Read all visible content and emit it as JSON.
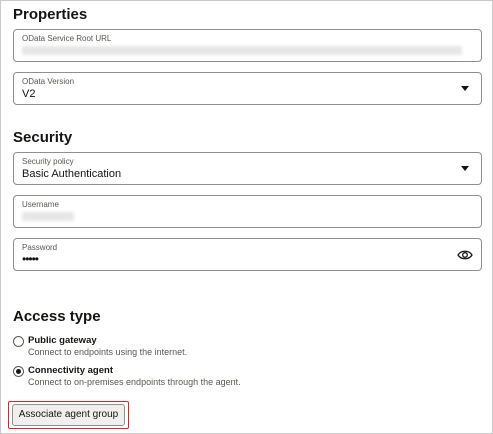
{
  "properties": {
    "heading": "Properties",
    "service_root_url": {
      "label": "OData Service Root URL",
      "value": ""
    },
    "odata_version": {
      "label": "OData Version",
      "value": "V2"
    }
  },
  "security": {
    "heading": "Security",
    "policy": {
      "label": "Security policy",
      "value": "Basic Authentication"
    },
    "username": {
      "label": "Username",
      "value": ""
    },
    "password": {
      "label": "Password",
      "value": "•••••"
    }
  },
  "access_type": {
    "heading": "Access type",
    "options": [
      {
        "title": "Public gateway",
        "description": "Connect to endpoints using the internet.",
        "checked": false
      },
      {
        "title": "Connectivity agent",
        "description": "Connect to on-premises endpoints through the agent.",
        "checked": true
      }
    ]
  },
  "actions": {
    "associate_label": "Associate agent group"
  },
  "icons": {
    "dropdown": "chevron-down-icon",
    "password_toggle": "eye-icon"
  },
  "colors": {
    "highlight": "#d8242b",
    "border": "#8f8f8f"
  }
}
